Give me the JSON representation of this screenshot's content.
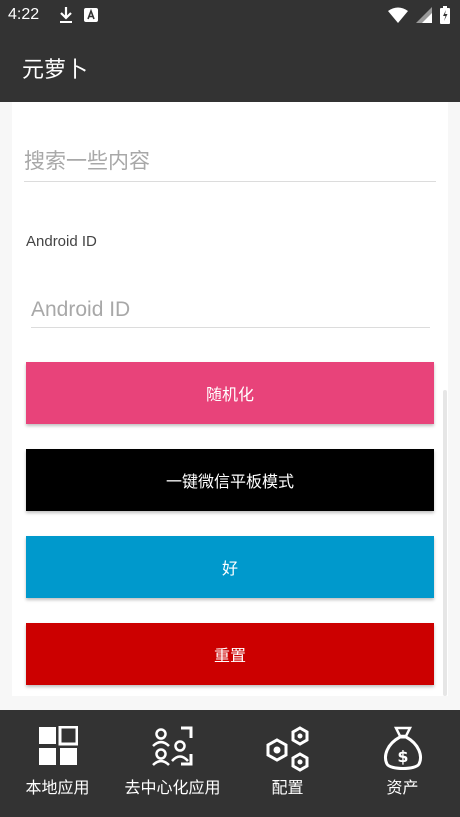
{
  "status_bar": {
    "time": "4:22"
  },
  "app": {
    "title": "元萝卜"
  },
  "search": {
    "placeholder": "搜索一些内容",
    "value": ""
  },
  "android_id": {
    "label": "Android ID",
    "placeholder": "Android ID",
    "value": ""
  },
  "buttons": [
    {
      "label": "随机化",
      "color": "#e8437a"
    },
    {
      "label": "一键微信平板模式",
      "color": "#000000"
    },
    {
      "label": "好",
      "color": "#0099cc"
    },
    {
      "label": "重置",
      "color": "#cc0000"
    }
  ],
  "nav": {
    "items": [
      {
        "label": "本地应用",
        "icon": "grid-icon"
      },
      {
        "label": "去中心化应用",
        "icon": "people-icon"
      },
      {
        "label": "配置",
        "icon": "hexagons-icon"
      },
      {
        "label": "资产",
        "icon": "money-bag-icon"
      }
    ]
  },
  "colors": {
    "bar": "#333333",
    "accent_pink": "#e8437a",
    "accent_blue": "#0099cc",
    "accent_red": "#cc0000"
  }
}
